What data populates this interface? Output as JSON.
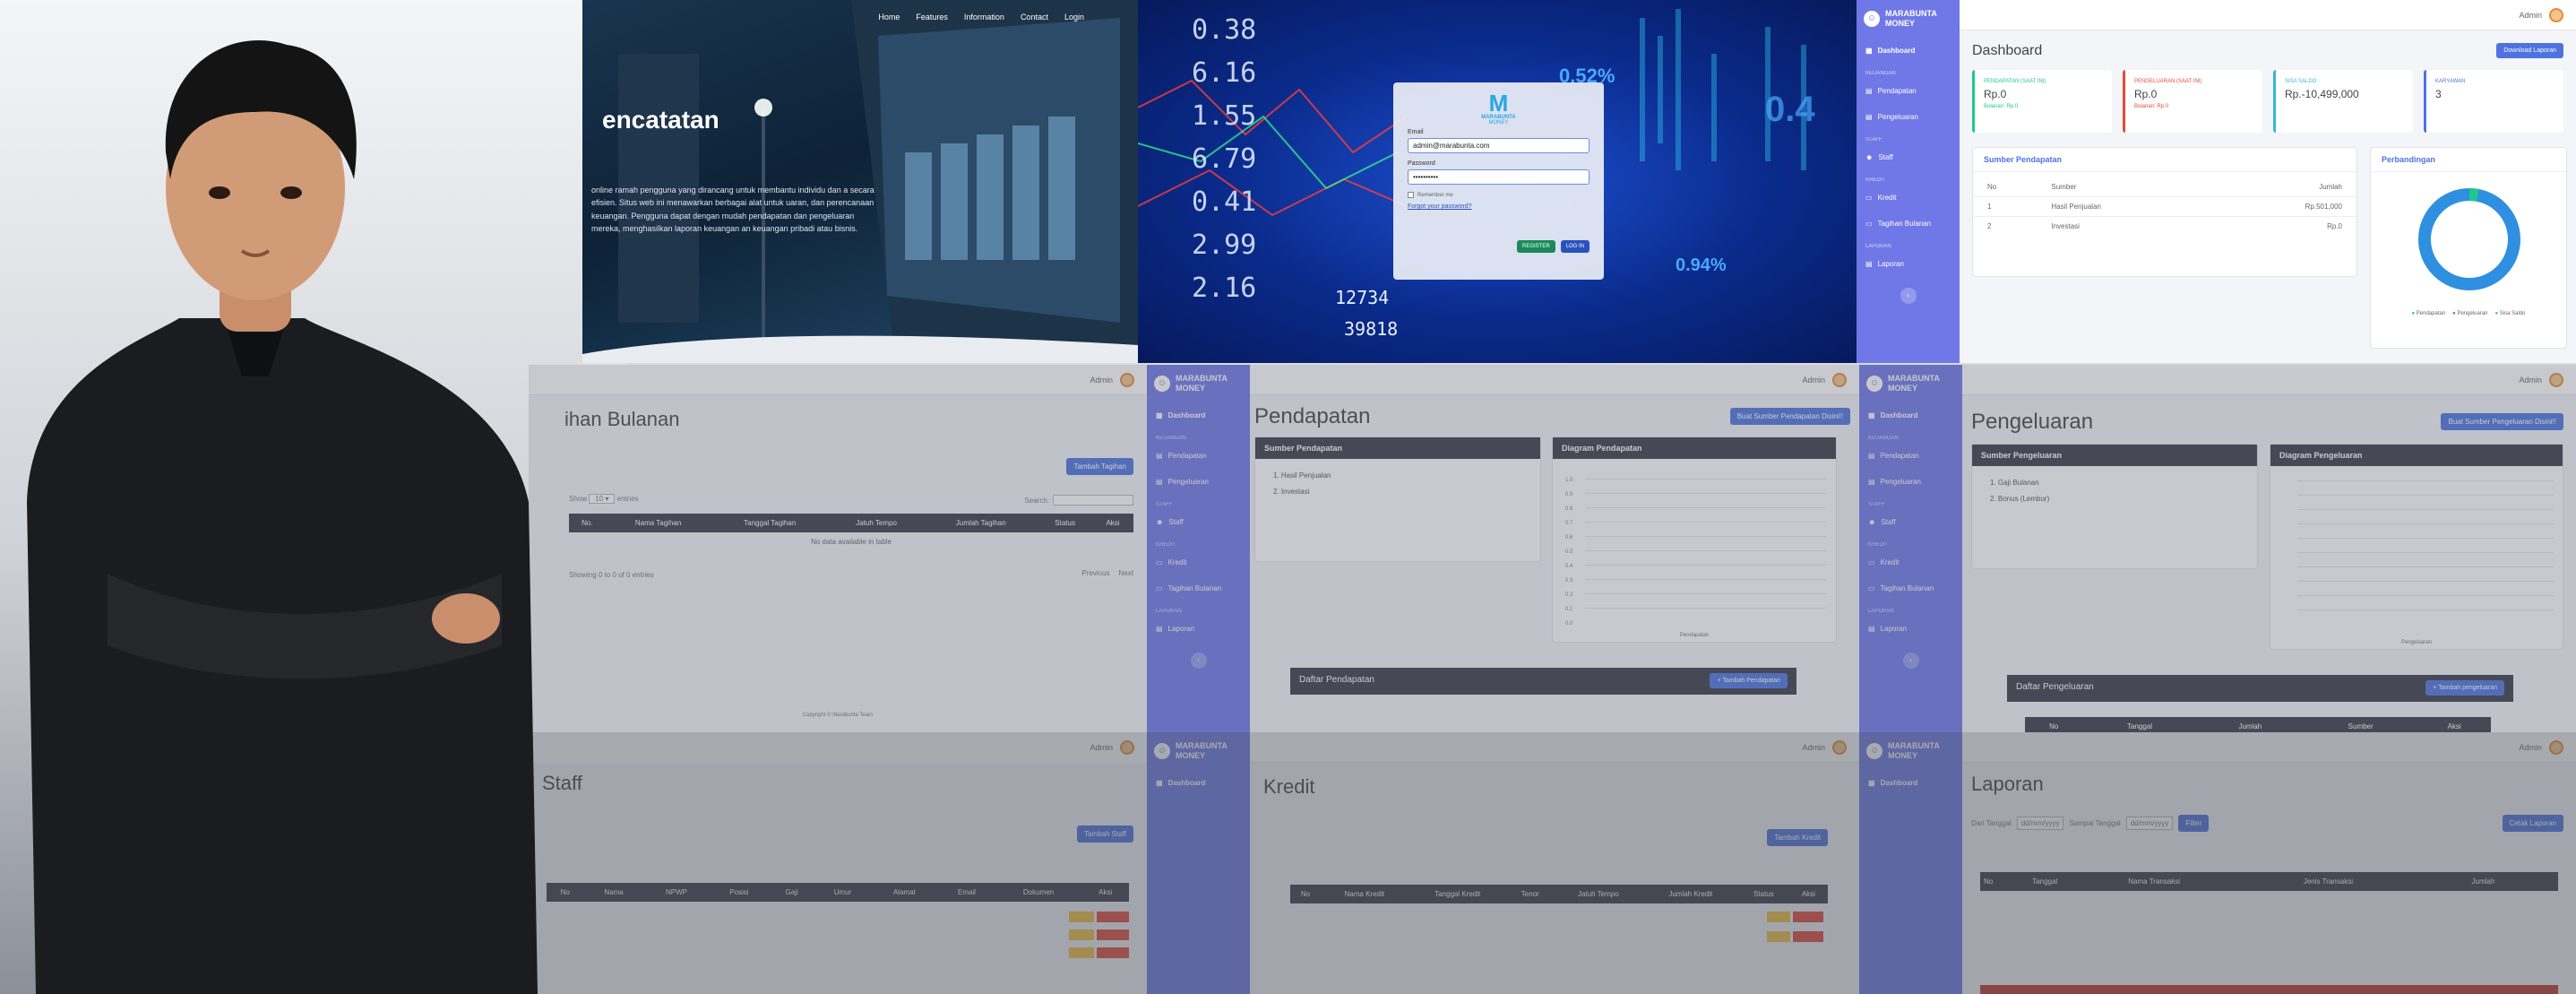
{
  "landing": {
    "nav": [
      "Home",
      "Features",
      "Information",
      "Contact",
      "Login"
    ],
    "headline": "encatatan",
    "desc": "online ramah pengguna yang dirancang untuk membantu individu dan a secara efisien. Situs web ini menawarkan berbagai alat untuk uaran, dan perencanaan keuangan. Pengguna dapat dengan mudah pendapatan dan pengeluaran mereka, menghasilkan laporan keuangan an keuangan pribadi atau bisnis."
  },
  "login": {
    "brand": "MARABUNTA",
    "brand2": "MONEY",
    "email_label": "Email",
    "email_value": "admin@marabunta.com",
    "password_label": "Password",
    "password_value": "••••••••••",
    "remember": "Remember me",
    "forgot": "Forgot your password?",
    "register": "REGISTER",
    "login": "LOG IN"
  },
  "tickers": [
    "0.38",
    "6.16",
    "1.55",
    "6.79",
    "0.41",
    "2.99",
    "2.16",
    "12734",
    "39818",
    "0.52%",
    "0.94%",
    "0.4"
  ],
  "brand": {
    "line1": "MARABUNTA",
    "line2": "MONEY"
  },
  "user": "Admin",
  "sidebar": {
    "dashboard": "Dashboard",
    "sec_keuangan": "Keuangan",
    "pendapatan": "Pendapatan",
    "pengeluaran": "Pengeluaran",
    "sec_staff": "Staff",
    "staff": "Staff",
    "sec_kredit": "Kredit",
    "kredit": "Kredit",
    "tagihan": "Tagihan Bulanan",
    "sec_laporan": "Laporan",
    "laporan": "Laporan"
  },
  "dashboard": {
    "title": "Dashboard",
    "download": "Download Laporan",
    "cards": [
      {
        "label": "PENDAPATAN (SAAT INI)",
        "value": "Rp.0",
        "sub": "Bulanan: Rp.0"
      },
      {
        "label": "PENGELUARAN (SAAT INI)",
        "value": "Rp.0",
        "sub": "Bulanan: Rp.0"
      },
      {
        "label": "SISA SALDO",
        "value": "Rp.-10,499,000",
        "sub": ""
      },
      {
        "label": "KARYAWAN",
        "value": "3",
        "sub": ""
      }
    ],
    "sumber_title": "Sumber Pendapatan",
    "cols": [
      "No",
      "Sumber",
      "Jumlah"
    ],
    "rows": [
      [
        "1",
        "Hasil Penjualan",
        "Rp.501,000"
      ],
      [
        "2",
        "Investasi",
        "Rp.0"
      ]
    ],
    "perbandingan": "Perbandingan",
    "legend": [
      "Pendapatan",
      "Pengeluaran",
      "Sisa Saldo"
    ],
    "donut": {
      "teal": 0.03,
      "blue": 0.97
    }
  },
  "tagihan": {
    "title": "ihan Bulanan",
    "add": "Tambah Tagihan",
    "show": "Show",
    "entries": "entries",
    "search": "Search:",
    "cols": [
      "No.",
      "Nama Tagihan",
      "Tanggal Tagihan",
      "Jatuh Tempo",
      "Jumlah Tagihan",
      "Status",
      "Aksi"
    ],
    "empty": "No data available in table",
    "info": "Showing 0 to 0 of 0 entries",
    "prev": "Previous",
    "next": "Next",
    "footer": "Copyright © Marabunta Team"
  },
  "pendapatan": {
    "title": "Pendapatan",
    "buat": "Buat Sumber Pendapatan Disini!!",
    "sumber": "Sumber Pendapatan",
    "items": [
      "1. Hasil Penjualan",
      "2. Investasi"
    ],
    "diagram": "Diagram Pendapatan",
    "ticks": [
      "1.0",
      "0.9",
      "0.8",
      "0.7",
      "0.6",
      "0.5",
      "0.4",
      "0.3",
      "0.2",
      "0.1",
      "0.0"
    ],
    "xlab": "Pendapatan",
    "daftar": "Daftar Pendapatan",
    "tambah": "Tambah Pendapatan"
  },
  "pengeluaran": {
    "title": "Pengeluaran",
    "buat": "Buat Sumber Pengeluaran Disini!!",
    "sumber": "Sumber Pengeluaran",
    "items": [
      "1. Gaji Bulanan",
      "2. Bonus (Lembur)"
    ],
    "diagram": "Diagram Pengeluaran",
    "xlab": "Pengeluaran",
    "daftar": "Daftar Pengeluaran",
    "tambah": "Tambah pengeluaran",
    "cols": [
      "No",
      "Tanggal",
      "Jumlah",
      "Sumber",
      "Aksi"
    ]
  },
  "staff": {
    "title": "Staff",
    "add": "Tambah Staff",
    "cols": [
      "No",
      "Nama",
      "NPWP",
      "Posisi",
      "Gaji",
      "Umur",
      "Alamat",
      "Email",
      "Dokumen",
      "Aksi"
    ]
  },
  "kredit": {
    "title": "Kredit",
    "add": "Tambah Kredit",
    "cols": [
      "No",
      "Nama Kredit",
      "Tanggal Kredit",
      "Tenor",
      "Jatuh Tempo",
      "Jumlah Kredit",
      "Status",
      "Aksi"
    ]
  },
  "laporan": {
    "title": "Laporan",
    "from": "Dari Tanggal",
    "to": "Sampai Tanggal",
    "date": "dd/mm/yyyy",
    "filter": "Filter",
    "cetak": "Cetak Laporan",
    "cols": [
      "No",
      "Tanggal",
      "Nama Transaksi",
      "Jenis Transaksi",
      "Jumlah"
    ]
  },
  "colors": {
    "sidebar": "#6f78e6",
    "header": "#3a3b45",
    "accent": "#4e73df",
    "green": "#1cc88a",
    "red": "#e74a3b",
    "teal": "#36b9cc"
  }
}
